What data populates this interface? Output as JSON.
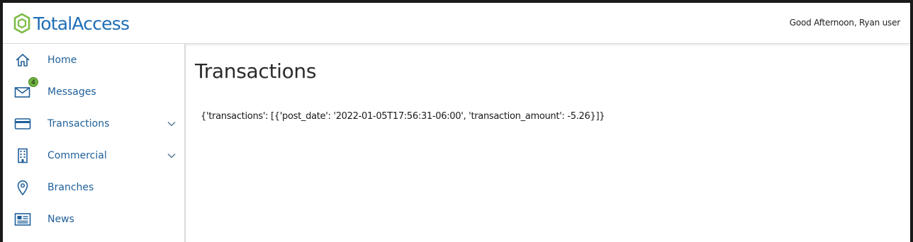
{
  "header": {
    "brand": "TotalAccess",
    "greeting": "Good Afternoon, Ryan user"
  },
  "sidebar": {
    "items": [
      {
        "label": "Home",
        "icon": "home-icon"
      },
      {
        "label": "Messages",
        "icon": "envelope-icon",
        "badge": "4"
      },
      {
        "label": "Transactions",
        "icon": "credit-card-icon",
        "expandable": true
      },
      {
        "label": "Commercial",
        "icon": "building-icon",
        "expandable": true
      },
      {
        "label": "Branches",
        "icon": "map-pin-icon"
      },
      {
        "label": "News",
        "icon": "newspaper-icon"
      }
    ]
  },
  "main": {
    "title": "Transactions",
    "content": "{'transactions': [{'post_date': '2022-01-05T17:56:31-06:00', 'transaction_amount': -5.26}]}"
  },
  "colors": {
    "brand_blue": "#1f6eb5",
    "brand_green": "#6fb23f",
    "nav_text": "#1f5f99"
  }
}
